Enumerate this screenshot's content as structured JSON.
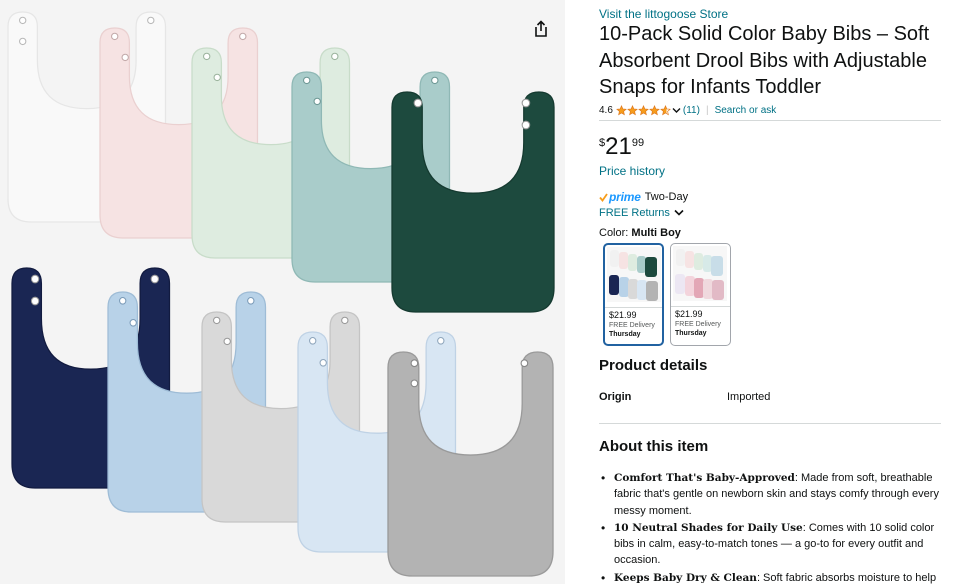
{
  "colors": {
    "link": "#007185",
    "star": "#f79d1b",
    "prime_blue": "#1a98ff",
    "swatch_selected_border": "#2162a1",
    "bib_palette": [
      "#f9f9f9",
      "#f6e3e3",
      "#deece0",
      "#a9ccca",
      "#1d4a3e",
      "#1a2653",
      "#b8d2e8",
      "#d9d9d9",
      "#d8e6f3",
      "#b3b3b3"
    ]
  },
  "image": {
    "icon": "share-icon"
  },
  "product": {
    "store_link": "Visit the littogoose Store",
    "title": "10-Pack Solid Color Baby Bibs – Soft Absorbent Drool Bibs with Adjustable Snaps for Infants Toddler",
    "rating": {
      "value": "4.6",
      "stars": 4.6,
      "count": "(11)",
      "separator": "|",
      "search_link": "Search or ask"
    },
    "price": {
      "symbol": "$",
      "whole": "21",
      "fraction": "99"
    },
    "price_history_link": "Price history",
    "prime": {
      "logo": "prime",
      "text": "Two-Day",
      "icon": "prime-check-icon"
    },
    "returns": {
      "text": "FREE Returns",
      "icon": "chevron-down-icon"
    },
    "color": {
      "label": "Color: ",
      "value": "Multi Boy"
    },
    "swatches": [
      {
        "price": "$21.99",
        "delivery": "FREE Delivery",
        "day": "Thursday",
        "selected": true
      },
      {
        "price": "$21.99",
        "delivery": "FREE Delivery",
        "day": "Thursday",
        "selected": false
      }
    ]
  },
  "details": {
    "heading": "Product details",
    "origin_label": "Origin",
    "origin_value": "Imported"
  },
  "about": {
    "heading": "About this item",
    "bullets": [
      {
        "title": "Comfort That's Baby-Approved",
        "text": ": Made from soft, breathable fabric that's gentle on newborn skin and stays comfy through every messy moment."
      },
      {
        "title": "10 Neutral Shades for Daily Use",
        "text": ": Comes with 10 solid color bibs in calm, easy-to-match tones — a go-to for every outfit and occasion."
      },
      {
        "title": "Keeps Baby Dry & Clean",
        "text": ": Soft fabric absorbs moisture to help"
      }
    ]
  }
}
